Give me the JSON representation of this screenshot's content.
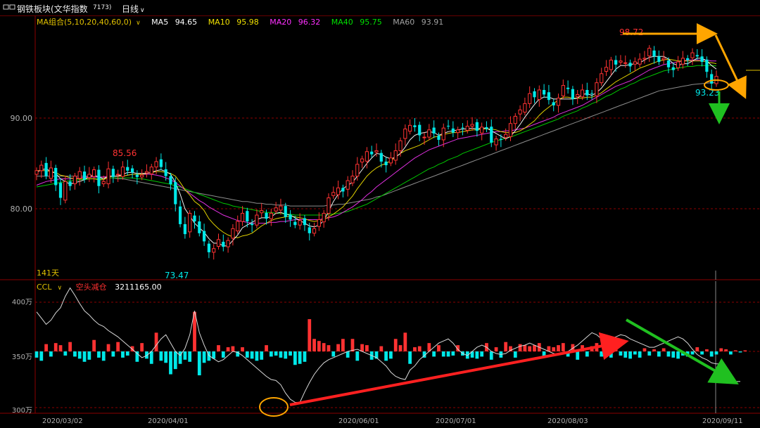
{
  "header": {
    "title": "钢铁板块(文华指数",
    "code": "7173)",
    "period": "日线",
    "period_chevron": "chevron-down-icon",
    "window_icon": "window-icon"
  },
  "ma_legend": {
    "group_label": "MA组合(5,10,20,40,60,0)",
    "items": [
      {
        "label": "MA5",
        "value": "94.65",
        "color": "#ffffff"
      },
      {
        "label": "MA10",
        "value": "95.98",
        "color": "#f0e000"
      },
      {
        "label": "MA20",
        "value": "96.32",
        "color": "#ff30ff"
      },
      {
        "label": "MA40",
        "value": "95.75",
        "color": "#00e000"
      },
      {
        "label": "MA60",
        "value": "93.91",
        "color": "#a0a0a0"
      }
    ]
  },
  "indicator_legend": {
    "name": "CCL",
    "signal": "空头减仓",
    "value": "3211165.00"
  },
  "colors": {
    "up": "#ff3232",
    "down": "#00e8e8",
    "grid": "#8b0000",
    "axis_text": "#b0b0b0",
    "annotation_orange": "#ffa500",
    "annotation_red": "#ff2020",
    "annotation_green": "#20c020"
  },
  "chart_data": [
    {
      "type": "candlestick",
      "ylim": [
        72,
        99.5
      ],
      "y_ticks": [
        "90.00",
        "80.00"
      ],
      "x_tick_labels": [
        "2020/03/02",
        "2020/04/01",
        "2020/06/01",
        "2020/07/01",
        "2020/08/03",
        "2020/09/11"
      ],
      "labels": {
        "high": "98.72",
        "low": "73.47",
        "left_peak": "85.56",
        "current_low": "93.23",
        "days": "141天"
      },
      "close": [
        84.2,
        84.8,
        83.6,
        84.5,
        82.6,
        81.2,
        83.0,
        82.5,
        83.6,
        84.1,
        83.2,
        83.8,
        84.3,
        82.5,
        83.0,
        84.4,
        83.5,
        83.8,
        84.6,
        84.2,
        84.0,
        83.5,
        83.7,
        84.1,
        84.6,
        85.2,
        84.6,
        83.6,
        82.7,
        80.5,
        78.3,
        77.2,
        79.5,
        78.6,
        77.3,
        76.4,
        75.2,
        75.6,
        76.6,
        75.8,
        76.5,
        77.8,
        78.6,
        79.5,
        78.6,
        78.2,
        79.3,
        79.8,
        78.9,
        79.5,
        80.1,
        80.3,
        79.1,
        78.8,
        78.2,
        78.7,
        78.2,
        77.3,
        77.8,
        78.8,
        79.5,
        81.2,
        81.8,
        82.3,
        81.9,
        83.1,
        83.6,
        84.9,
        85.5,
        86.3,
        86.0,
        86.4,
        85.2,
        84.8,
        85.6,
        86.4,
        87.5,
        88.8,
        89.2,
        89.0,
        88.1,
        87.9,
        88.7,
        88.3,
        87.6,
        88.9,
        89.1,
        88.4,
        88.7,
        88.9,
        89.1,
        89.3,
        88.6,
        89.0,
        88.8,
        87.3,
        87.7,
        87.6,
        88.2,
        89.4,
        90.2,
        90.9,
        91.6,
        92.7,
        92.3,
        93.1,
        92.6,
        92.0,
        91.4,
        92.2,
        93.6,
        93.2,
        92.1,
        92.6,
        93.1,
        92.5,
        92.7,
        93.9,
        94.9,
        95.6,
        96.4,
        95.9,
        96.3,
        96.1,
        95.7,
        96.2,
        96.5,
        96.6,
        97.7,
        96.8,
        96.2,
        96.6,
        95.6,
        95.3,
        96.2,
        96.6,
        96.4,
        97.2,
        96.8,
        96.2,
        95.1,
        93.8,
        94.6
      ],
      "ma5": [
        84.0,
        84.3,
        84.4,
        84.1,
        83.9,
        83.3,
        83.0,
        82.7,
        82.9,
        83.0,
        83.2,
        83.6,
        83.7,
        83.5,
        83.3,
        83.6,
        83.6,
        83.6,
        83.8,
        84.0,
        84.0,
        83.9,
        83.9,
        83.9,
        84.0,
        84.2,
        84.3,
        84.1,
        83.8,
        82.9,
        81.6,
        80.0,
        79.2,
        78.4,
        77.9,
        77.4,
        76.7,
        76.2,
        76.2,
        75.9,
        75.9,
        76.5,
        77.1,
        77.9,
        78.2,
        78.5,
        78.8,
        79.0,
        79.0,
        79.1,
        79.5,
        79.6,
        79.4,
        79.3,
        79.0,
        78.7,
        78.4,
        78.1,
        78.0,
        78.2,
        78.7,
        79.7,
        80.8,
        81.6,
        82.2,
        82.6,
        82.9,
        83.6,
        84.3,
        85.0,
        85.6,
        86.1,
        86.0,
        85.7,
        85.5,
        85.7,
        86.1,
        86.8,
        87.6,
        88.1,
        88.3,
        88.4,
        88.5,
        88.4,
        88.1,
        88.3,
        88.5,
        88.6,
        88.7,
        88.8,
        88.8,
        88.9,
        88.8,
        88.9,
        88.9,
        88.6,
        88.3,
        88.0,
        87.7,
        88.0,
        88.6,
        89.3,
        90.1,
        90.8,
        91.5,
        92.1,
        92.3,
        92.3,
        92.1,
        92.1,
        92.1,
        92.1,
        92.1,
        92.2,
        92.6,
        92.7,
        92.5,
        92.8,
        93.3,
        94.0,
        94.7,
        95.4,
        95.8,
        95.8,
        95.9,
        96.0,
        96.1,
        96.4,
        96.7,
        96.8,
        96.8,
        96.8,
        96.5,
        96.0,
        95.8,
        96.0,
        96.0,
        96.3,
        96.6,
        96.6,
        96.3,
        95.8,
        95.4
      ],
      "ma10": [
        84.2,
        84.2,
        84.2,
        84.1,
        84.0,
        83.7,
        83.6,
        83.4,
        83.3,
        83.3,
        83.3,
        83.3,
        83.3,
        83.2,
        83.2,
        83.5,
        83.6,
        83.6,
        83.6,
        83.7,
        83.8,
        83.8,
        83.8,
        83.9,
        84.0,
        84.1,
        84.1,
        84.0,
        83.9,
        83.6,
        82.9,
        82.1,
        81.5,
        80.8,
        80.4,
        79.8,
        78.9,
        78.3,
        77.8,
        77.4,
        77.1,
        76.9,
        76.8,
        77.0,
        77.1,
        77.3,
        77.7,
        78.1,
        78.4,
        78.7,
        78.9,
        79.0,
        79.1,
        79.2,
        79.1,
        79.0,
        78.9,
        78.7,
        78.6,
        78.7,
        78.8,
        79.1,
        79.4,
        79.8,
        80.2,
        80.8,
        81.4,
        82.2,
        82.9,
        83.6,
        84.1,
        84.5,
        84.8,
        85.0,
        85.3,
        85.7,
        86.1,
        86.4,
        86.6,
        86.8,
        87.0,
        87.3,
        87.6,
        87.9,
        88.0,
        88.2,
        88.3,
        88.4,
        88.4,
        88.5,
        88.6,
        88.7,
        88.7,
        88.8,
        88.8,
        88.8,
        88.7,
        88.5,
        88.4,
        88.4,
        88.4,
        88.6,
        88.9,
        89.3,
        89.7,
        90.3,
        90.8,
        91.2,
        91.6,
        92.0,
        92.3,
        92.3,
        92.2,
        92.2,
        92.2,
        92.3,
        92.3,
        92.5,
        92.8,
        93.2,
        93.6,
        94.0,
        94.3,
        94.6,
        94.9,
        95.2,
        95.5,
        95.7,
        95.9,
        96.1,
        96.3,
        96.4,
        96.5,
        96.4,
        96.3,
        96.3,
        96.3,
        96.3,
        96.3,
        96.3,
        96.2,
        96.1,
        96.0
      ],
      "ma20": [
        82.6,
        82.8,
        83.0,
        83.1,
        83.2,
        83.3,
        83.3,
        83.3,
        83.4,
        83.4,
        83.5,
        83.5,
        83.5,
        83.5,
        83.5,
        83.6,
        83.6,
        83.6,
        83.6,
        83.7,
        83.8,
        83.8,
        83.8,
        83.8,
        83.8,
        83.7,
        83.6,
        83.4,
        83.2,
        82.9,
        82.5,
        82.1,
        81.7,
        81.3,
        80.9,
        80.6,
        80.2,
        79.9,
        79.6,
        79.3,
        79.1,
        78.9,
        78.7,
        78.6,
        78.5,
        78.4,
        78.4,
        78.4,
        78.4,
        78.5,
        78.5,
        78.6,
        78.6,
        78.7,
        78.8,
        78.8,
        78.8,
        78.8,
        78.8,
        78.8,
        78.9,
        79.0,
        79.1,
        79.3,
        79.6,
        79.9,
        80.2,
        80.6,
        81.0,
        81.5,
        81.9,
        82.4,
        82.8,
        83.2,
        83.6,
        84.0,
        84.4,
        84.8,
        85.2,
        85.6,
        85.9,
        86.2,
        86.5,
        86.7,
        86.9,
        87.1,
        87.3,
        87.5,
        87.7,
        87.8,
        87.9,
        88.0,
        88.1,
        88.2,
        88.3,
        88.4,
        88.5,
        88.5,
        88.6,
        88.6,
        88.7,
        88.8,
        88.9,
        89.1,
        89.3,
        89.5,
        89.7,
        89.9,
        90.1,
        90.4,
        90.6,
        90.8,
        91.0,
        91.2,
        91.4,
        91.7,
        92.0,
        92.3,
        92.6,
        92.9,
        93.2,
        93.5,
        93.7,
        93.9,
        94.1,
        94.4,
        94.7,
        95.0,
        95.3,
        95.5,
        95.7,
        95.9,
        96.0,
        96.1,
        96.2,
        96.3,
        96.4,
        96.4,
        96.4,
        96.4,
        96.4,
        96.3,
        96.3
      ],
      "ma40": [
        82.4,
        82.5,
        82.6,
        82.7,
        82.8,
        82.9,
        83.0,
        83.1,
        83.1,
        83.2,
        83.2,
        83.3,
        83.3,
        83.3,
        83.3,
        83.4,
        83.4,
        83.4,
        83.4,
        83.4,
        83.4,
        83.3,
        83.3,
        83.2,
        83.1,
        83.0,
        82.9,
        82.8,
        82.7,
        82.5,
        82.4,
        82.2,
        82.0,
        81.8,
        81.6,
        81.4,
        81.2,
        81.0,
        80.8,
        80.6,
        80.5,
        80.3,
        80.2,
        80.1,
        80.0,
        79.9,
        79.8,
        79.7,
        79.6,
        79.6,
        79.5,
        79.5,
        79.4,
        79.4,
        79.3,
        79.3,
        79.3,
        79.3,
        79.3,
        79.3,
        79.3,
        79.4,
        79.4,
        79.5,
        79.6,
        79.7,
        79.9,
        80.1,
        80.3,
        80.5,
        80.8,
        81.1,
        81.4,
        81.7,
        82.0,
        82.3,
        82.6,
        82.9,
        83.2,
        83.5,
        83.8,
        84.1,
        84.4,
        84.6,
        84.9,
        85.1,
        85.4,
        85.6,
        85.8,
        86.1,
        86.3,
        86.5,
        86.7,
        86.9,
        87.1,
        87.3,
        87.5,
        87.6,
        87.8,
        87.9,
        88.1,
        88.3,
        88.5,
        88.7,
        88.9,
        89.1,
        89.3,
        89.5,
        89.7,
        89.9,
        90.2,
        90.4,
        90.6,
        90.8,
        91.1,
        91.3,
        91.6,
        91.8,
        92.1,
        92.4,
        92.6,
        92.9,
        93.2,
        93.4,
        93.7,
        93.9,
        94.2,
        94.4,
        94.6,
        94.8,
        95.0,
        95.2,
        95.3,
        95.4,
        95.5,
        95.6,
        95.7,
        95.7,
        95.8,
        95.8,
        95.8,
        95.8,
        95.75
      ],
      "ma60": [
        83.6,
        83.6,
        83.6,
        83.6,
        83.6,
        83.6,
        83.6,
        83.6,
        83.6,
        83.6,
        83.6,
        83.6,
        83.5,
        83.5,
        83.5,
        83.4,
        83.4,
        83.3,
        83.3,
        83.2,
        83.1,
        83.0,
        82.9,
        82.8,
        82.7,
        82.6,
        82.5,
        82.4,
        82.3,
        82.2,
        82.1,
        82.0,
        81.9,
        81.8,
        81.7,
        81.6,
        81.5,
        81.4,
        81.3,
        81.2,
        81.1,
        81.0,
        80.9,
        80.8,
        80.8,
        80.7,
        80.6,
        80.6,
        80.5,
        80.5,
        80.4,
        80.4,
        80.4,
        80.3,
        80.3,
        80.3,
        80.3,
        80.3,
        80.3,
        80.3,
        80.3,
        80.4,
        80.4,
        80.5,
        80.5,
        80.6,
        80.7,
        80.8,
        80.9,
        81.0,
        81.1,
        81.3,
        81.4,
        81.6,
        81.8,
        82.0,
        82.2,
        82.4,
        82.6,
        82.8,
        83.0,
        83.2,
        83.4,
        83.6,
        83.8,
        84.0,
        84.2,
        84.4,
        84.6,
        84.8,
        85.0,
        85.2,
        85.4,
        85.6,
        85.8,
        86.0,
        86.2,
        86.4,
        86.6,
        86.8,
        87.0,
        87.2,
        87.4,
        87.6,
        87.8,
        88.0,
        88.2,
        88.4,
        88.6,
        88.8,
        89.0,
        89.2,
        89.4,
        89.6,
        89.8,
        90.0,
        90.2,
        90.4,
        90.6,
        90.8,
        91.0,
        91.2,
        91.4,
        91.6,
        91.8,
        92.0,
        92.2,
        92.4,
        92.6,
        92.8,
        93.0,
        93.1,
        93.2,
        93.3,
        93.4,
        93.5,
        93.6,
        93.7,
        93.75,
        93.8,
        93.85,
        93.9,
        93.91
      ]
    },
    {
      "type": "bar",
      "name": "CCL",
      "ylim": [
        2950000,
        4200000
      ],
      "y_ticks": [
        "400万",
        "350万",
        "300万"
      ],
      "baseline": 3500000,
      "line_values": [
        3880000,
        3820000,
        3760000,
        3800000,
        3870000,
        3920000,
        4030000,
        4110000,
        4040000,
        3960000,
        3890000,
        3850000,
        3800000,
        3760000,
        3740000,
        3700000,
        3670000,
        3640000,
        3600000,
        3560000,
        3520000,
        3480000,
        3440000,
        3460000,
        3500000,
        3560000,
        3620000,
        3660000,
        3580000,
        3500000,
        3460000,
        3530000,
        3660000,
        3890000,
        3680000,
        3560000,
        3460000,
        3430000,
        3400000,
        3420000,
        3460000,
        3500000,
        3490000,
        3460000,
        3420000,
        3380000,
        3340000,
        3300000,
        3260000,
        3230000,
        3220000,
        3180000,
        3100000,
        3040000,
        3010000,
        3010000,
        3110000,
        3200000,
        3280000,
        3340000,
        3390000,
        3420000,
        3440000,
        3460000,
        3480000,
        3500000,
        3510000,
        3520000,
        3500000,
        3480000,
        3460000,
        3440000,
        3400000,
        3360000,
        3300000,
        3260000,
        3240000,
        3230000,
        3320000,
        3360000,
        3420000,
        3460000,
        3500000,
        3540000,
        3580000,
        3600000,
        3620000,
        3580000,
        3520000,
        3480000,
        3460000,
        3500000,
        3540000,
        3560000,
        3540000,
        3500000,
        3480000,
        3470000,
        3480000,
        3510000,
        3530000,
        3550000,
        3560000,
        3580000,
        3560000,
        3540000,
        3520000,
        3500000,
        3480000,
        3470000,
        3480000,
        3500000,
        3530000,
        3560000,
        3600000,
        3640000,
        3680000,
        3660000,
        3620000,
        3600000,
        3620000,
        3640000,
        3660000,
        3650000,
        3620000,
        3600000,
        3580000,
        3560000,
        3540000,
        3540000,
        3560000,
        3580000,
        3600000,
        3620000,
        3640000,
        3620000,
        3580000,
        3520000,
        3470000,
        3440000,
        3420000,
        3390000,
        3380000,
        3380000,
        3300000,
        3240000,
        3210000,
        3211165
      ],
      "bar_changes": [
        -60000,
        -90000,
        70000,
        -50000,
        80000,
        60000,
        -40000,
        90000,
        -50000,
        -70000,
        -100000,
        -80000,
        110000,
        -60000,
        -90000,
        70000,
        -50000,
        90000,
        -60000,
        -40000,
        50000,
        -100000,
        80000,
        -70000,
        -120000,
        180000,
        -90000,
        -110000,
        -220000,
        -170000,
        -120000,
        -80000,
        -100000,
        380000,
        -230000,
        -110000,
        -90000,
        -70000,
        60000,
        -60000,
        40000,
        50000,
        -50000,
        40000,
        -60000,
        -70000,
        -90000,
        -80000,
        60000,
        -50000,
        -40000,
        -60000,
        -70000,
        -40000,
        -130000,
        -120000,
        -100000,
        310000,
        120000,
        100000,
        80000,
        60000,
        -50000,
        70000,
        120000,
        -60000,
        120000,
        -90000,
        70000,
        60000,
        -80000,
        -70000,
        50000,
        -90000,
        -70000,
        120000,
        60000,
        180000,
        -120000,
        40000,
        50000,
        -60000,
        80000,
        -50000,
        60000,
        -50000,
        -50000,
        -40000,
        60000,
        -40000,
        -70000,
        -60000,
        -70000,
        -50000,
        80000,
        -80000,
        40000,
        -60000,
        90000,
        50000,
        -60000,
        70000,
        60000,
        50000,
        60000,
        80000,
        -60000,
        50000,
        40000,
        60000,
        80000,
        -50000,
        70000,
        -80000,
        60000,
        -50000,
        50000,
        80000,
        -50000,
        60000,
        -60000,
        30000,
        -40000,
        -60000,
        -70000,
        -30000,
        -60000,
        30000,
        -40000,
        20000,
        -50000,
        30000,
        -50000,
        -60000,
        -70000,
        -40000,
        -50000,
        -30000,
        40000,
        -30000,
        20000,
        -50000,
        -30000,
        30000,
        20000,
        -30000,
        10000,
        -10000,
        10000
      ]
    }
  ],
  "annotations": {
    "labels": {
      "high": "98.72",
      "current": "93.23",
      "low": "73.47",
      "left_peak": "85.56"
    }
  }
}
